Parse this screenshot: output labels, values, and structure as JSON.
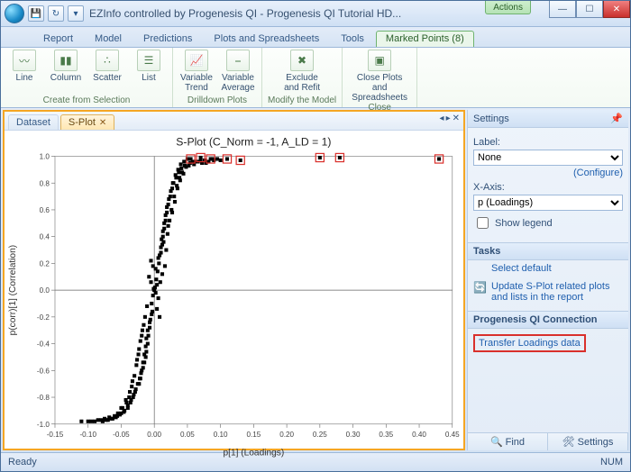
{
  "window": {
    "title": "EZInfo controlled by Progenesis QI - Progenesis QI Tutorial HD...",
    "context_tab_header": "Actions"
  },
  "ribbon_tabs": [
    "Report",
    "Model",
    "Predictions",
    "Plots and Spreadsheets",
    "Tools",
    "Marked Points (8)"
  ],
  "ribbon_active_tab_index": 5,
  "ribbon_groups": {
    "g1": {
      "label": "Create from Selection",
      "btns": [
        "Line",
        "Column",
        "Scatter",
        "List"
      ]
    },
    "g2": {
      "label": "Drilldown Plots",
      "btns": [
        "Variable Trend",
        "Variable Average"
      ]
    },
    "g3": {
      "label": "Modify the Model",
      "btns": [
        "Exclude and Refit"
      ]
    },
    "g4": {
      "label": "Close",
      "btns": [
        "Close Plots and Spreadsheets"
      ]
    }
  },
  "doc_tabs": {
    "dataset": "Dataset",
    "splot": "S-Plot"
  },
  "plot": {
    "title": "S-Plot (C_Norm = -1, A_LD = 1)",
    "xlabel": "p[1] (Loadings)",
    "ylabel": "p(corr)[1] (Correlation)"
  },
  "settings": {
    "title": "Settings",
    "label_lbl": "Label:",
    "label_val": "None",
    "configure": "(Configure)",
    "xaxis_lbl": "X-Axis:",
    "xaxis_val": "p (Loadings)",
    "show_legend": "Show legend"
  },
  "tasks": {
    "title": "Tasks",
    "t1": "Select default",
    "t2": "Update S-Plot related plots and lists in the report"
  },
  "conn": {
    "title": "Progenesis QI Connection",
    "link": "Transfer Loadings data"
  },
  "footer_tabs": {
    "find": "Find",
    "settings": "Settings"
  },
  "status": {
    "left": "Ready",
    "right": "NUM"
  },
  "chart_data": {
    "type": "scatter",
    "title": "S-Plot (C_Norm = -1, A_LD = 1)",
    "xlabel": "p[1] (Loadings)",
    "ylabel": "p(corr)[1] (Correlation)",
    "xlim": [
      -0.15,
      0.45
    ],
    "ylim": [
      -1.0,
      1.0
    ],
    "xticks": [
      -0.15,
      -0.1,
      -0.05,
      -0.0,
      0.05,
      0.1,
      0.15,
      0.2,
      0.25,
      0.3,
      0.35,
      0.4,
      0.45
    ],
    "yticks": [
      -1.0,
      -0.8,
      -0.6,
      -0.4,
      -0.2,
      -0.0,
      0.2,
      0.4,
      0.6,
      0.8,
      1.0
    ],
    "marked_points": [
      {
        "x": 0.055,
        "y": 0.98
      },
      {
        "x": 0.07,
        "y": 0.99
      },
      {
        "x": 0.085,
        "y": 0.98
      },
      {
        "x": 0.11,
        "y": 0.98
      },
      {
        "x": 0.13,
        "y": 0.97
      },
      {
        "x": 0.25,
        "y": 0.99
      },
      {
        "x": 0.28,
        "y": 0.99
      },
      {
        "x": 0.43,
        "y": 0.98
      }
    ],
    "points": [
      {
        "x": 0.001,
        "y": 0.02
      },
      {
        "x": -0.002,
        "y": -0.04
      },
      {
        "x": 0.003,
        "y": 0.08
      },
      {
        "x": -0.004,
        "y": -0.1
      },
      {
        "x": 0.005,
        "y": 0.14
      },
      {
        "x": -0.003,
        "y": -0.16
      },
      {
        "x": 0.007,
        "y": 0.2
      },
      {
        "x": -0.006,
        "y": -0.22
      },
      {
        "x": 0.008,
        "y": 0.26
      },
      {
        "x": -0.007,
        "y": -0.28
      },
      {
        "x": 0.01,
        "y": 0.32
      },
      {
        "x": -0.009,
        "y": -0.34
      },
      {
        "x": 0.011,
        "y": 0.38
      },
      {
        "x": -0.01,
        "y": -0.4
      },
      {
        "x": 0.013,
        "y": 0.44
      },
      {
        "x": -0.012,
        "y": -0.46
      },
      {
        "x": 0.015,
        "y": 0.5
      },
      {
        "x": -0.013,
        "y": -0.5
      },
      {
        "x": 0.017,
        "y": 0.56
      },
      {
        "x": -0.015,
        "y": -0.54
      },
      {
        "x": 0.019,
        "y": 0.62
      },
      {
        "x": -0.017,
        "y": -0.58
      },
      {
        "x": 0.022,
        "y": 0.68
      },
      {
        "x": -0.02,
        "y": -0.62
      },
      {
        "x": 0.025,
        "y": 0.74
      },
      {
        "x": -0.022,
        "y": -0.66
      },
      {
        "x": 0.028,
        "y": 0.8
      },
      {
        "x": -0.025,
        "y": -0.7
      },
      {
        "x": 0.032,
        "y": 0.86
      },
      {
        "x": -0.028,
        "y": -0.74
      },
      {
        "x": 0.036,
        "y": 0.9
      },
      {
        "x": -0.031,
        "y": -0.78
      },
      {
        "x": 0.04,
        "y": 0.94
      },
      {
        "x": -0.035,
        "y": -0.82
      },
      {
        "x": 0.045,
        "y": 0.96
      },
      {
        "x": -0.04,
        "y": -0.86
      },
      {
        "x": 0.05,
        "y": 0.98
      },
      {
        "x": -0.045,
        "y": -0.9
      },
      {
        "x": 0.058,
        "y": 0.96
      },
      {
        "x": -0.05,
        "y": -0.92
      },
      {
        "x": 0.066,
        "y": 0.96
      },
      {
        "x": -0.056,
        "y": -0.94
      },
      {
        "x": 0.078,
        "y": 0.95
      },
      {
        "x": -0.063,
        "y": -0.96
      },
      {
        "x": 0.09,
        "y": 0.97
      },
      {
        "x": -0.07,
        "y": -0.97
      },
      {
        "x": 0.095,
        "y": 0.98
      },
      {
        "x": -0.078,
        "y": -0.98
      },
      {
        "x": 0.018,
        "y": 0.3
      },
      {
        "x": 0.016,
        "y": 0.18
      },
      {
        "x": 0.012,
        "y": 0.12
      },
      {
        "x": 0.009,
        "y": 0.06
      },
      {
        "x": -0.011,
        "y": -0.12
      },
      {
        "x": -0.014,
        "y": -0.2
      },
      {
        "x": -0.018,
        "y": -0.3
      },
      {
        "x": -0.021,
        "y": -0.38
      },
      {
        "x": 0.02,
        "y": 0.42
      },
      {
        "x": 0.023,
        "y": 0.52
      },
      {
        "x": 0.026,
        "y": 0.6
      },
      {
        "x": 0.03,
        "y": 0.7
      },
      {
        "x": -0.024,
        "y": -0.48
      },
      {
        "x": -0.027,
        "y": -0.56
      },
      {
        "x": -0.03,
        "y": -0.64
      },
      {
        "x": -0.034,
        "y": -0.72
      },
      {
        "x": 0.034,
        "y": 0.78
      },
      {
        "x": 0.038,
        "y": 0.84
      },
      {
        "x": 0.042,
        "y": 0.88
      },
      {
        "x": 0.048,
        "y": 0.92
      },
      {
        "x": -0.038,
        "y": -0.8
      },
      {
        "x": -0.042,
        "y": -0.84
      },
      {
        "x": -0.048,
        "y": -0.88
      },
      {
        "x": -0.055,
        "y": -0.92
      },
      {
        "x": 0.06,
        "y": 0.94
      },
      {
        "x": 0.072,
        "y": 0.95
      },
      {
        "x": 0.082,
        "y": 0.96
      },
      {
        "x": 0.1,
        "y": 0.97
      },
      {
        "x": -0.06,
        "y": -0.94
      },
      {
        "x": -0.068,
        "y": -0.95
      },
      {
        "x": -0.075,
        "y": -0.96
      },
      {
        "x": -0.085,
        "y": -0.97
      },
      {
        "x": -0.09,
        "y": -0.98
      },
      {
        "x": -0.1,
        "y": -0.98
      },
      {
        "x": -0.11,
        "y": -0.98
      },
      {
        "x": 0.004,
        "y": 0.04
      },
      {
        "x": 0.002,
        "y": -0.02
      },
      {
        "x": -0.001,
        "y": 0.01
      },
      {
        "x": -0.005,
        "y": 0.06
      },
      {
        "x": 0.006,
        "y": -0.06
      },
      {
        "x": -0.008,
        "y": 0.1
      },
      {
        "x": 0.0,
        "y": 0.0
      },
      {
        "x": 0.014,
        "y": 0.36
      },
      {
        "x": 0.021,
        "y": 0.48
      },
      {
        "x": 0.027,
        "y": 0.58
      },
      {
        "x": 0.031,
        "y": 0.66
      },
      {
        "x": -0.016,
        "y": -0.26
      },
      {
        "x": -0.019,
        "y": -0.34
      },
      {
        "x": -0.023,
        "y": -0.44
      },
      {
        "x": -0.026,
        "y": -0.52
      },
      {
        "x": 0.035,
        "y": 0.76
      },
      {
        "x": 0.039,
        "y": 0.82
      },
      {
        "x": 0.044,
        "y": 0.87
      },
      {
        "x": 0.052,
        "y": 0.93
      },
      {
        "x": -0.033,
        "y": -0.68
      },
      {
        "x": -0.037,
        "y": -0.76
      },
      {
        "x": -0.043,
        "y": -0.82
      },
      {
        "x": -0.05,
        "y": -0.88
      },
      {
        "x": 0.002,
        "y": 0.16
      },
      {
        "x": -0.002,
        "y": 0.18
      },
      {
        "x": 0.004,
        "y": -0.14
      },
      {
        "x": -0.004,
        "y": -0.18
      },
      {
        "x": 0.006,
        "y": 0.24
      },
      {
        "x": -0.005,
        "y": 0.22
      },
      {
        "x": 0.008,
        "y": -0.2
      },
      {
        "x": -0.007,
        "y": -0.24
      },
      {
        "x": 0.01,
        "y": 0.28
      },
      {
        "x": 0.012,
        "y": 0.34
      },
      {
        "x": 0.013,
        "y": 0.4
      },
      {
        "x": 0.015,
        "y": 0.46
      },
      {
        "x": -0.01,
        "y": -0.3
      },
      {
        "x": -0.012,
        "y": -0.36
      },
      {
        "x": -0.013,
        "y": -0.42
      },
      {
        "x": -0.015,
        "y": -0.48
      },
      {
        "x": 0.017,
        "y": 0.52
      },
      {
        "x": 0.019,
        "y": 0.58
      },
      {
        "x": 0.021,
        "y": 0.64
      },
      {
        "x": 0.024,
        "y": 0.7
      },
      {
        "x": -0.017,
        "y": -0.54
      },
      {
        "x": -0.019,
        "y": -0.6
      },
      {
        "x": -0.021,
        "y": -0.66
      },
      {
        "x": -0.023,
        "y": -0.7
      },
      {
        "x": 0.027,
        "y": 0.76
      },
      {
        "x": 0.029,
        "y": 0.8
      },
      {
        "x": 0.033,
        "y": 0.84
      },
      {
        "x": 0.037,
        "y": 0.88
      },
      {
        "x": -0.029,
        "y": -0.76
      },
      {
        "x": -0.032,
        "y": -0.8
      },
      {
        "x": -0.036,
        "y": -0.84
      },
      {
        "x": -0.04,
        "y": -0.88
      },
      {
        "x": 0.041,
        "y": 0.91
      },
      {
        "x": 0.046,
        "y": 0.93
      },
      {
        "x": 0.054,
        "y": 0.95
      },
      {
        "x": 0.062,
        "y": 0.96
      },
      {
        "x": -0.046,
        "y": -0.91
      },
      {
        "x": -0.052,
        "y": -0.93
      },
      {
        "x": -0.058,
        "y": -0.95
      },
      {
        "x": -0.065,
        "y": -0.96
      },
      {
        "x": 0.07,
        "y": 0.97
      },
      {
        "x": 0.076,
        "y": 0.97
      },
      {
        "x": 0.088,
        "y": 0.98
      },
      {
        "x": -0.073,
        "y": -0.97
      },
      {
        "x": -0.08,
        "y": -0.97
      },
      {
        "x": -0.095,
        "y": -0.98
      }
    ]
  }
}
